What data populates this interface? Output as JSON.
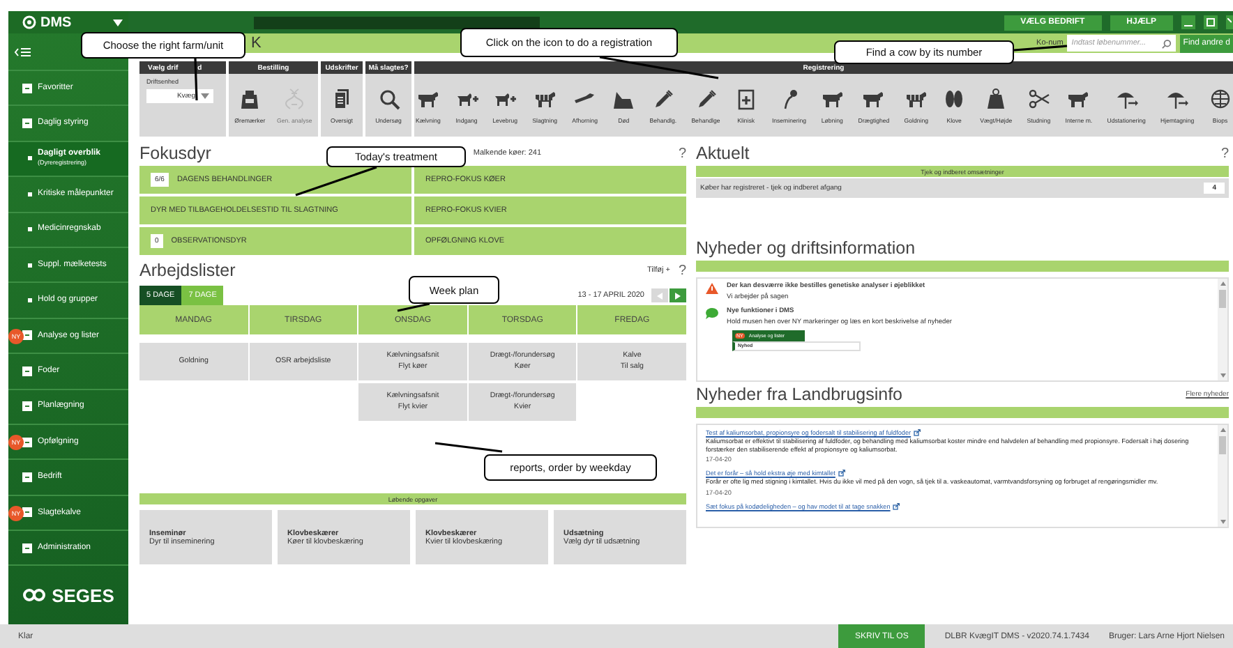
{
  "sidebar": {
    "logo": "DMS",
    "items": [
      {
        "label": "Favoritter",
        "kind": "group",
        "selected": false
      },
      {
        "label": "Daglig styring",
        "kind": "group",
        "selected": false
      },
      {
        "label": "Dagligt overblik",
        "sublabel": "(Dyreregistrering)",
        "kind": "sub",
        "selected": true
      },
      {
        "label": "Kritiske målepunkter",
        "kind": "sub",
        "selected": false
      },
      {
        "label": "Medicinregnskab",
        "kind": "sub",
        "selected": false
      },
      {
        "label": "Suppl. mælketests",
        "kind": "sub",
        "selected": false
      },
      {
        "label": "Hold og grupper",
        "kind": "sub",
        "selected": false
      },
      {
        "label": "Analyse og lister",
        "kind": "group",
        "selected": false,
        "badge": "NY"
      },
      {
        "label": "Foder",
        "kind": "group",
        "selected": false
      },
      {
        "label": "Planlægning",
        "kind": "group",
        "selected": false
      },
      {
        "label": "Opfølgning",
        "kind": "group",
        "selected": false,
        "badge": "NY"
      },
      {
        "label": "Bedrift",
        "kind": "group",
        "selected": false
      },
      {
        "label": "Slagtekalve",
        "kind": "group",
        "selected": false,
        "badge": "NY"
      },
      {
        "label": "Administration",
        "kind": "group",
        "selected": false
      }
    ],
    "brand": "SEGES"
  },
  "topbar": {
    "buttons": [
      "VÆLG BEDRIFT",
      "HJÆLP"
    ]
  },
  "subbar": {
    "page_title": "K",
    "search_label": "Ko-num",
    "search": {
      "placeholder": "Indtast løbenummer..."
    },
    "find_button": "Find andre d"
  },
  "toolbar": {
    "farm": {
      "title": "Vælg drif",
      "title_tail": "d",
      "label": "Driftsenhed",
      "value": "Kvæg"
    },
    "groups": [
      {
        "title": "Bestilling",
        "tools": [
          {
            "label": "Øremærker",
            "disabled": false
          },
          {
            "label": "Gen. analyse",
            "disabled": true
          }
        ]
      },
      {
        "title": "Udskrifter",
        "tools": [
          {
            "label": "Oversigt",
            "disabled": false
          }
        ]
      },
      {
        "title": "Må slagtes?",
        "tools": [
          {
            "label": "Undersøg",
            "disabled": false
          }
        ]
      },
      {
        "title": "Registrering",
        "tools": [
          {
            "label": "Kælvning",
            "disabled": false
          },
          {
            "label": "Indgang",
            "disabled": false
          },
          {
            "label": "Levebrug",
            "disabled": false
          },
          {
            "label": "Slagtning",
            "disabled": false
          },
          {
            "label": "Afhorning",
            "disabled": false
          },
          {
            "label": "Død",
            "disabled": false
          },
          {
            "label": "Behandlg.",
            "disabled": false
          },
          {
            "label": "Behandlge",
            "disabled": false
          },
          {
            "label": "Klinisk",
            "disabled": false
          },
          {
            "label": "Inseminering",
            "disabled": false
          },
          {
            "label": "Løbning",
            "disabled": false
          },
          {
            "label": "Drægtighed",
            "disabled": false
          },
          {
            "label": "Goldning",
            "disabled": false
          },
          {
            "label": "Klove",
            "disabled": false
          },
          {
            "label": "Vægt/Højde",
            "disabled": false
          },
          {
            "label": "Studning",
            "disabled": false
          },
          {
            "label": "Interne m.",
            "disabled": false
          },
          {
            "label": "Udstationering",
            "disabled": false
          },
          {
            "label": "Hjemtagning",
            "disabled": false
          },
          {
            "label": "Biops",
            "disabled": false
          }
        ]
      }
    ]
  },
  "fokusdyr": {
    "title": "Fokusdyr",
    "info": "Malkende køer: 241",
    "help": "?",
    "tiles": [
      {
        "label": "DAGENS BEHANDLINGER",
        "count": "6/6"
      },
      {
        "label": "REPRO-FOKUS KØER"
      },
      {
        "label": "DYR MED TILBAGEHOLDELSESTID TIL SLAGTNING"
      },
      {
        "label": "REPRO-FOKUS KVIER"
      },
      {
        "label": "OBSERVATIONSDYR",
        "count": "0"
      },
      {
        "label": "OPFØLGNING KLOVE"
      }
    ]
  },
  "arbejdslister": {
    "title": "Arbejdslister",
    "add": "Tilføj +",
    "help": "?",
    "tabs": [
      {
        "label": "5 DAGE",
        "selected": true
      },
      {
        "label": "7 DAGE",
        "selected": false
      }
    ],
    "range": "13 - 17 APRIL 2020",
    "days": [
      {
        "name": "MANDAG",
        "items": [
          "Goldning"
        ]
      },
      {
        "name": "TIRSDAG",
        "items": [
          "OSR arbejdsliste"
        ]
      },
      {
        "name": "ONSDAG",
        "items": [
          "Kælvningsafsnit\nFlyt køer",
          "Kælvningsafsnit\nFlyt kvier"
        ]
      },
      {
        "name": "TORSDAG",
        "items": [
          "Drægt-/forundersøg\nKøer",
          "Drægt-/forundersøg\nKvier"
        ]
      },
      {
        "name": "FREDAG",
        "items": [
          "Kalve\nTil salg"
        ]
      }
    ]
  },
  "lobende": {
    "title": "Løbende opgaver",
    "cards": [
      {
        "title": "Inseminør",
        "text": "Dyr til inseminering"
      },
      {
        "title": "Klovbeskærer",
        "text": "Køer til klovbeskæring"
      },
      {
        "title": "Klovbeskærer",
        "text": "Kvier til klovbeskæring"
      },
      {
        "title": "Udsætning",
        "text": "Vælg dyr til udsætning"
      }
    ]
  },
  "aktuelt": {
    "title": "Aktuelt",
    "help": "?",
    "bar": "Tjek og indberet omsætninger",
    "rows": [
      {
        "text": "Køber har registreret - tjek og indberet afgang",
        "count": "4"
      }
    ]
  },
  "drift": {
    "title": "Nyheder og driftsinformation",
    "items": [
      {
        "kind": "warning",
        "title": "Der kan desværre ikke bestilles genetiske analyser i øjeblikket",
        "text": "Vi arbejder på sagen"
      },
      {
        "kind": "info",
        "title": "Nye funktioner i DMS",
        "text": "Hold musen hen over NY markeringer og læs en kort beskrivelse af nyheder",
        "preview": {
          "badge": "NY",
          "menu": "Analyse og lister",
          "tip": "Nyhed"
        }
      }
    ]
  },
  "landbrugsinfo": {
    "title": "Nyheder fra Landbrugsinfo",
    "more": "Flere nyheder",
    "news": [
      {
        "title": "Test af kaliumsorbat, propionsyre og fodersalt til stabilisering af fuldfoder",
        "text": "Kaliumsorbat er effektivt til stabilisering af fuldfoder, og behandling med kaliumsorbat koster mindre end halvdelen af behandling med propionsyre. Fodersalt i høj dosering forstærker den stabiliserende effekt af propionsyre og kaliumsorbat.",
        "date": "17-04-20"
      },
      {
        "title": "Det er forår – så hold ekstra øje med kimtallet",
        "text": "Forår er ofte lig med stigning i kimtallet. Hvis du ikke vil med på den vogn, så tjek til a. vaskeautomat, varmtvandsforsyning og forbruget af rengøringsmidler mv.",
        "date": "17-04-20"
      },
      {
        "title": "Sæt fokus på kodødeligheden – og hav modet til at tage snakken"
      }
    ]
  },
  "status_bar": {
    "text": "Klar",
    "button": "SKRIV TIL OS",
    "version": "DLBR KvægIT DMS - v2020.74.1.7434",
    "user": "Bruger: Lars Arne Hjort Nielsen"
  },
  "callouts": [
    "Choose the right farm/unit",
    "Click on the icon to do a registration",
    "Find a cow by its number",
    "Today's treatment",
    "Week plan",
    "reports, order by weekday"
  ]
}
